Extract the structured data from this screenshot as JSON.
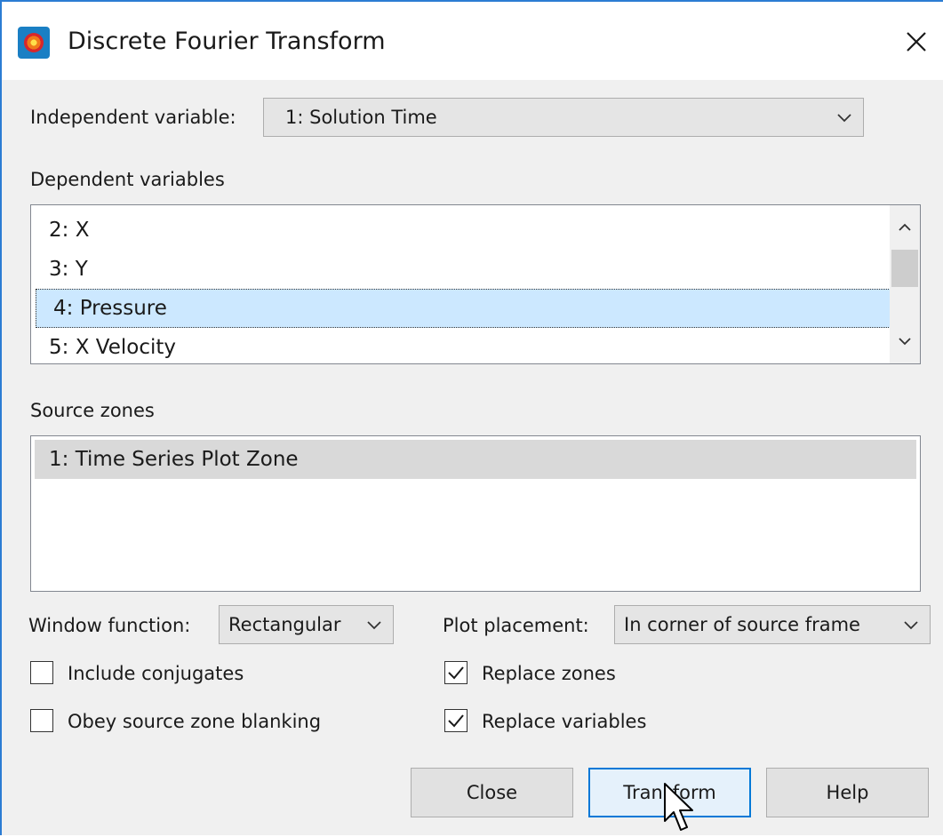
{
  "window": {
    "title": "Discrete Fourier Transform"
  },
  "independent_variable": {
    "label": "Independent variable:",
    "value": "1: Solution Time"
  },
  "dependent_variables": {
    "label": "Dependent variables",
    "items": [
      "2: X",
      "3: Y",
      "4: Pressure",
      "5: X Velocity"
    ],
    "selected": "4: Pressure"
  },
  "source_zones": {
    "label": "Source zones",
    "items": [
      "1: Time Series Plot Zone"
    ]
  },
  "window_function": {
    "label": "Window function:",
    "value": "Rectangular"
  },
  "plot_placement": {
    "label": "Plot placement:",
    "value": "In corner of source frame"
  },
  "options": {
    "include_conjugates": {
      "label": "Include conjugates",
      "checked": false
    },
    "obey_blanking": {
      "label": "Obey source zone blanking",
      "checked": false
    },
    "replace_zones": {
      "label": "Replace zones",
      "checked": true
    },
    "replace_variables": {
      "label": "Replace variables",
      "checked": true
    }
  },
  "buttons": {
    "close": "Close",
    "transform": "Transform",
    "help": "Help"
  },
  "icons": {
    "app": "tecplot-app-icon",
    "close": "close-icon",
    "dropdown": "chevron-down-icon",
    "scroll_up": "chevron-up-icon",
    "scroll_down": "chevron-down-icon",
    "check": "checkmark-icon",
    "cursor": "mouse-pointer-icon"
  },
  "colors": {
    "accent": "#0078d7",
    "selection": "#cce8ff",
    "window_border": "#2b7cd3"
  }
}
